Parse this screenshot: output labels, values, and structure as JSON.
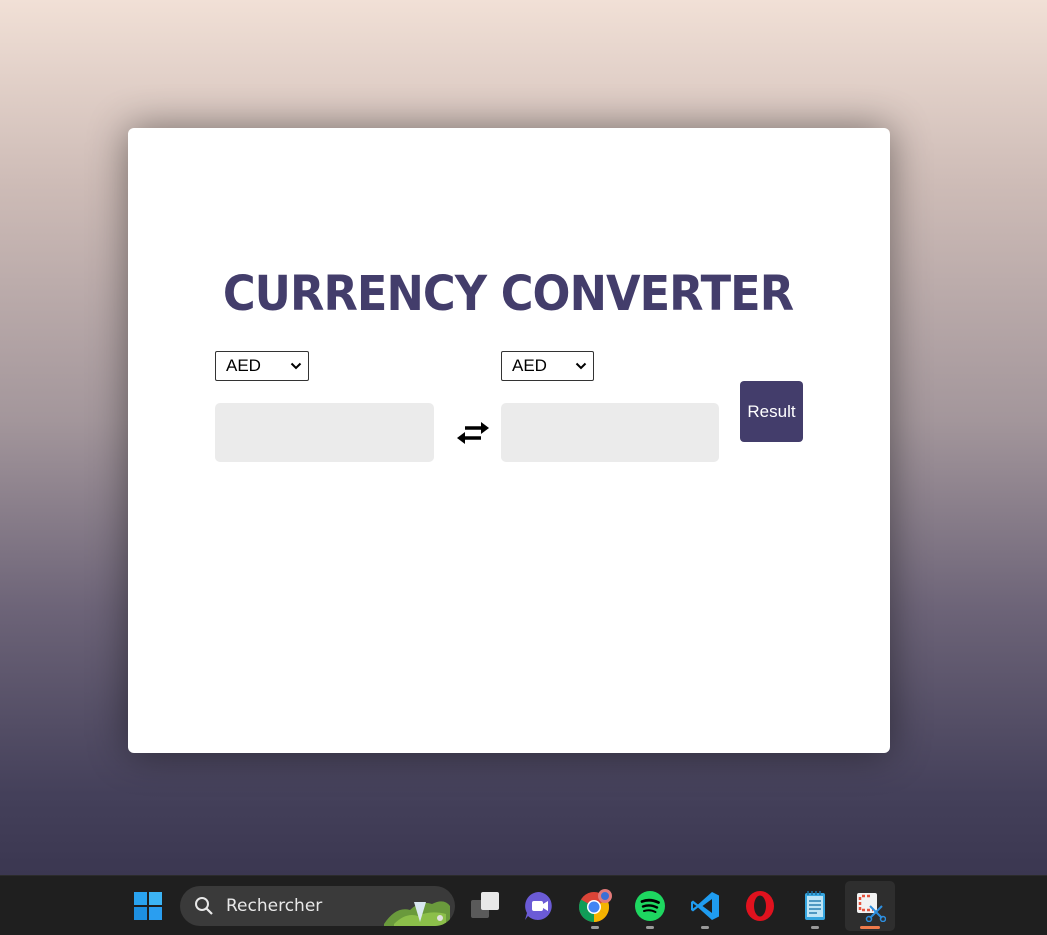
{
  "app": {
    "title": "CURRENCY CONVERTER",
    "from_currency": "AED",
    "to_currency": "AED",
    "from_amount": "",
    "to_amount": "",
    "result_label": "Result",
    "swap_icon": "swap-arrows-icon",
    "accent_color": "#433d6b",
    "input_bg_color": "#ebebeb"
  },
  "taskbar": {
    "search_placeholder": "Rechercher",
    "icons": [
      "windows-start-icon",
      "search-icon",
      "task-view-icon",
      "meet-icon",
      "chrome-icon",
      "spotify-icon",
      "vscode-icon",
      "opera-icon",
      "notepad-icon",
      "snipping-tool-icon"
    ]
  }
}
